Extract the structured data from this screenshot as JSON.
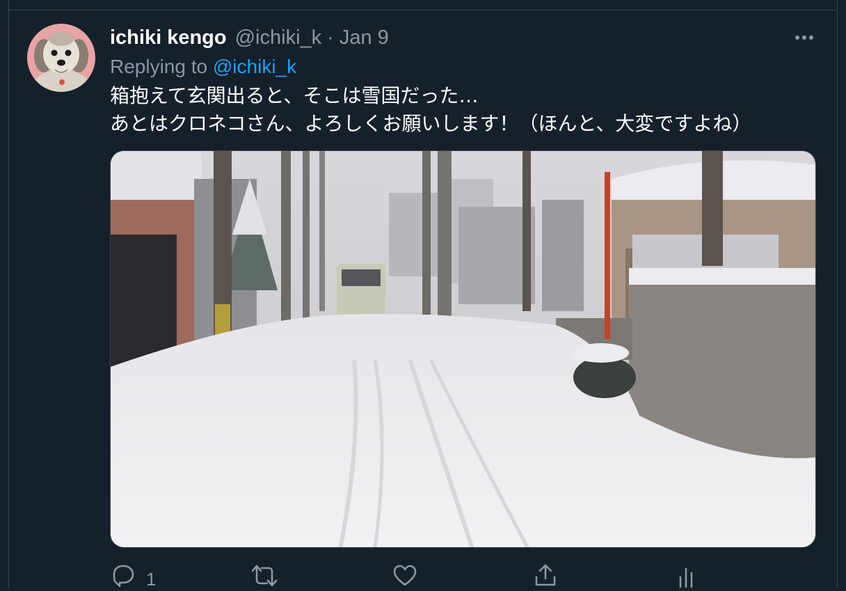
{
  "tweet": {
    "author_name": "ichiki kengo",
    "author_handle": "@ichiki_k",
    "separator": "·",
    "date": "Jan 9",
    "replying_prefix": "Replying to",
    "replying_to": "@ichiki_k",
    "text_line_1": "箱抱えて玄関出ると、そこは雪国だった…",
    "text_line_2": "あとはクロネコさん、よろしくお願いします！（ほんと、大変ですよね）"
  },
  "actions": {
    "reply_count": "1",
    "retweet_count": "",
    "like_count": ""
  },
  "icons": {
    "more": "more-horizontal-icon",
    "reply": "reply-icon",
    "retweet": "retweet-icon",
    "like": "heart-icon",
    "share": "share-icon",
    "analytics": "analytics-icon"
  },
  "colors": {
    "background": "#15202b",
    "border": "#38444d",
    "secondary_text": "#8899a6",
    "accent": "#1da1f2"
  }
}
